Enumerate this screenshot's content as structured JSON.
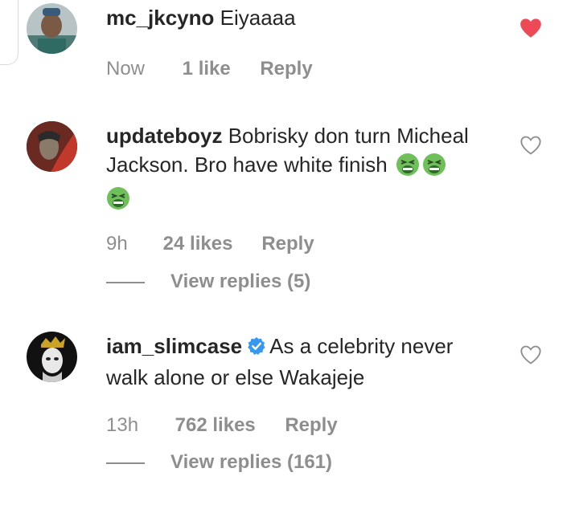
{
  "comments": [
    {
      "username": "mc_jkcyno",
      "text": "Eiyaaaa",
      "time": "Now",
      "likes": "1 like",
      "reply": "Reply",
      "liked": true
    },
    {
      "username": "updateboyz",
      "text": "Bobrisky don turn Micheal Jackson. Bro have white finish",
      "emoji": "nauseated-face-emoji",
      "time": "9h",
      "likes": "24 likes",
      "reply": "Reply",
      "view_replies": "View replies (5)",
      "liked": false
    },
    {
      "username": "iam_slimcase",
      "verified": true,
      "text": "As a celebrity never walk alone or else Wakajeje",
      "time": "13h",
      "likes": "762 likes",
      "reply": "Reply",
      "view_replies": "View replies (161)",
      "liked": false
    }
  ],
  "colors": {
    "heart_liked": "#ed4956",
    "verified_badge": "#3897f0",
    "meta_text": "#8e8e8e",
    "primary_text": "#262626"
  }
}
